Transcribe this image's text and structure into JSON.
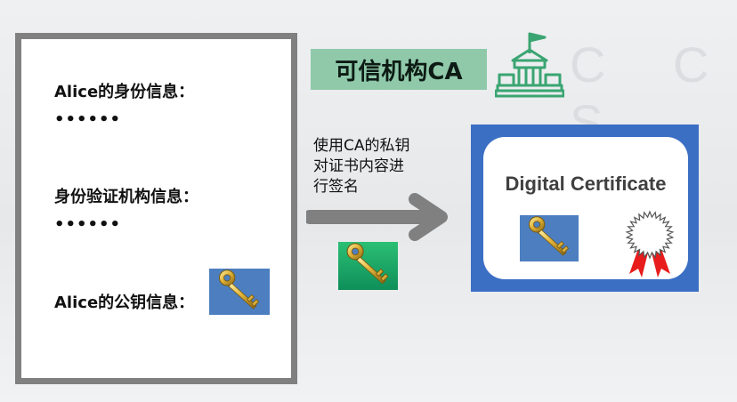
{
  "subject": {
    "identity_label": "Alice的身份信息：",
    "identity_dots": "••••••",
    "authority_label": "身份验证机构信息：",
    "authority_dots": "••••••",
    "pubkey_label": "Alice的公钥信息："
  },
  "ca": {
    "label": "可信机构CA",
    "icon": "government-building-icon"
  },
  "signing": {
    "caption_line1": "使用CA的私钥",
    "caption_line2": "对证书内容进",
    "caption_line3": "行签名",
    "private_key_icon": "golden-key-icon",
    "private_key_bg": "#1aa86a"
  },
  "certificate": {
    "title": "Digital Certificate",
    "key_icon": "golden-key-icon",
    "seal_icon": "award-seal-icon"
  },
  "colors": {
    "ca_label_bg": "#8fc9aa",
    "cert_frame": "#3b6fc4",
    "arrow": "#808080",
    "key_tile_blue": "#4d7fc0",
    "building": "#3aa572"
  }
}
